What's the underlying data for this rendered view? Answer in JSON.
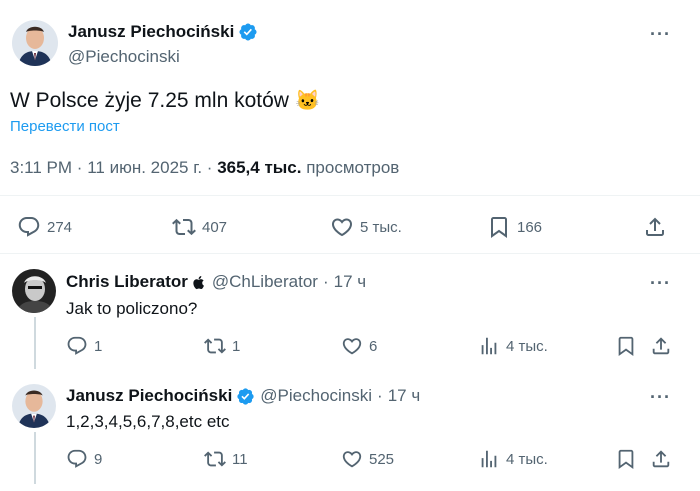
{
  "main_tweet": {
    "author_name": "Janusz Piechociński",
    "author_handle": "@Piechocinski",
    "text": "W Polsce żyje 7.25 mln kotów",
    "emoji": "🐱",
    "translate_label": "Перевести пост",
    "time": "3:11 PM",
    "date": "11 июн. 2025 г.",
    "separator": "·",
    "views_count": "365,4 тыс.",
    "views_label": "просмотров",
    "actions": {
      "replies": "274",
      "retweets": "407",
      "likes": "5 тыс.",
      "bookmarks": "166"
    }
  },
  "replies": [
    {
      "author_name": "Chris Liberator",
      "badge_icon": "apple-icon",
      "author_handle": "@ChLiberator",
      "separator": "·",
      "time": "17 ч",
      "text": "Jak to policzono?",
      "actions": {
        "replies": "1",
        "retweets": "1",
        "likes": "6",
        "views": "4 тыс."
      }
    },
    {
      "author_name": "Janusz Piechociński",
      "badge_icon": "verified-badge-icon",
      "author_handle": "@Piechocinski",
      "separator": "·",
      "time": "17 ч",
      "text": "1,2,3,4,5,6,7,8,etc etc",
      "actions": {
        "replies": "9",
        "retweets": "11",
        "likes": "525",
        "views": "4 тыс."
      }
    }
  ],
  "colors": {
    "verified_blue": "#1d9bf0",
    "text_primary": "#0f1419",
    "text_secondary": "#536471",
    "thread_line": "#cfd9de"
  }
}
